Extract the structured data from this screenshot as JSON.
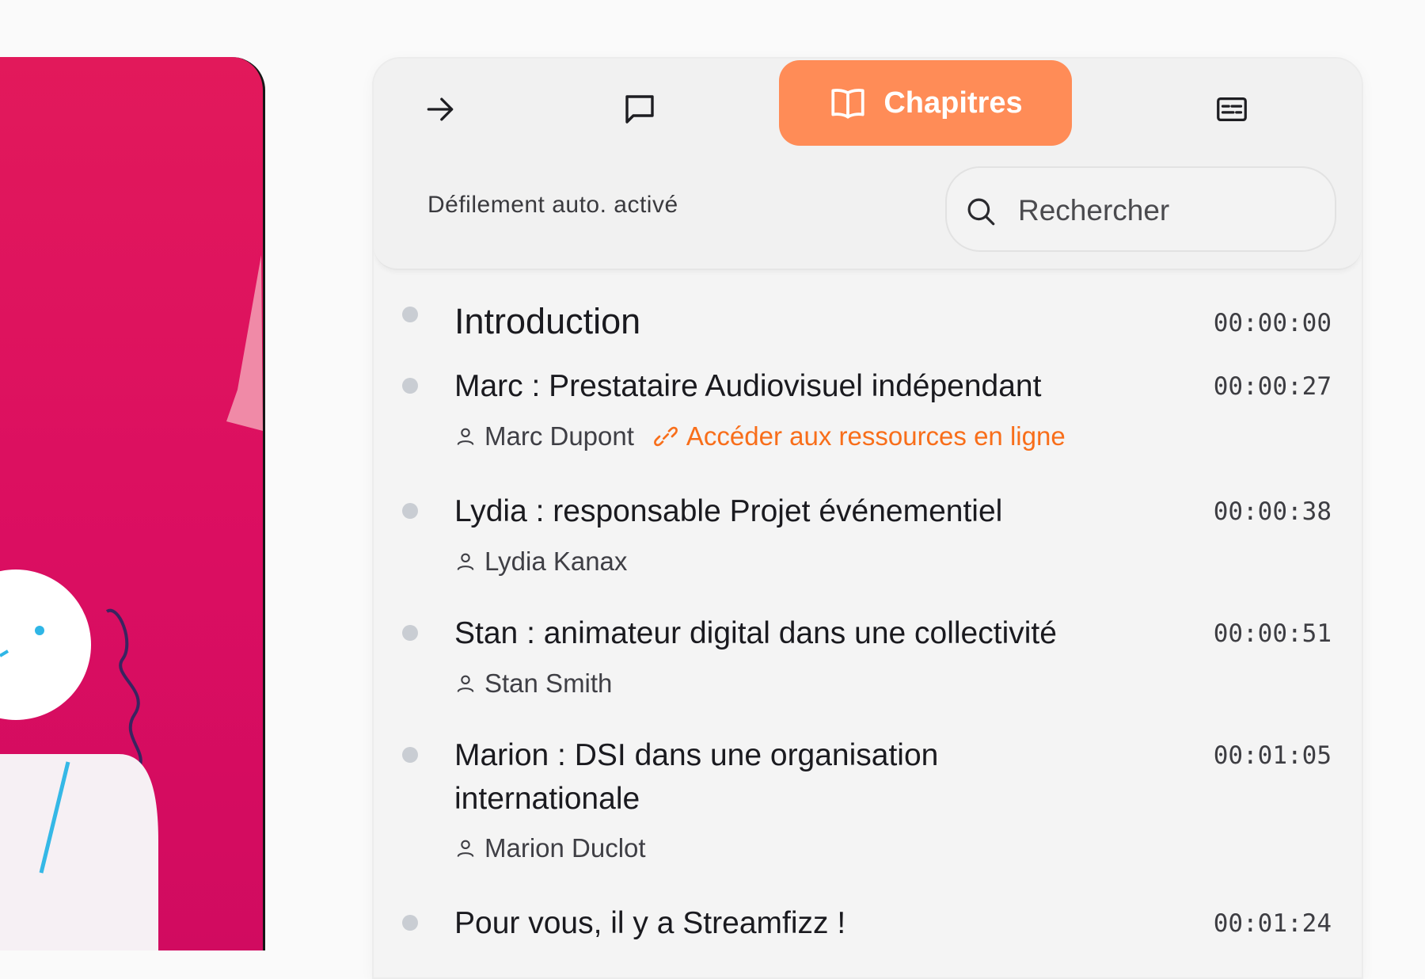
{
  "tabs": {
    "forward_icon": "arrow-right-icon",
    "comments_icon": "message-square-icon",
    "chapters_label": "Chapitres",
    "chapters_icon": "book-open-icon",
    "transcript_icon": "captions-icon"
  },
  "autoscroll_label": "Défilement auto. activé",
  "search": {
    "placeholder": "Rechercher",
    "value": ""
  },
  "colors": {
    "accent": "#ff8c57",
    "link": "#f86e1a",
    "video_bg": "#e0135e"
  },
  "chapters": [
    {
      "title": "Introduction",
      "time": "00:00:00"
    },
    {
      "title": "Marc : Prestataire Audiovisuel indépendant",
      "time": "00:00:27",
      "speaker": "Marc Dupont",
      "link": "Accéder aux ressources en ligne"
    },
    {
      "title": "Lydia : responsable Projet événementiel",
      "time": "00:00:38",
      "speaker": "Lydia Kanax"
    },
    {
      "title": "Stan : animateur digital dans une collectivité",
      "time": "00:00:51",
      "speaker": "Stan Smith"
    },
    {
      "title": "Marion : DSI dans une organisation internationale",
      "time": "00:01:05",
      "speaker": "Marion Duclot"
    },
    {
      "title": "Pour vous, il y a Streamfizz !",
      "time": "00:01:24"
    }
  ]
}
